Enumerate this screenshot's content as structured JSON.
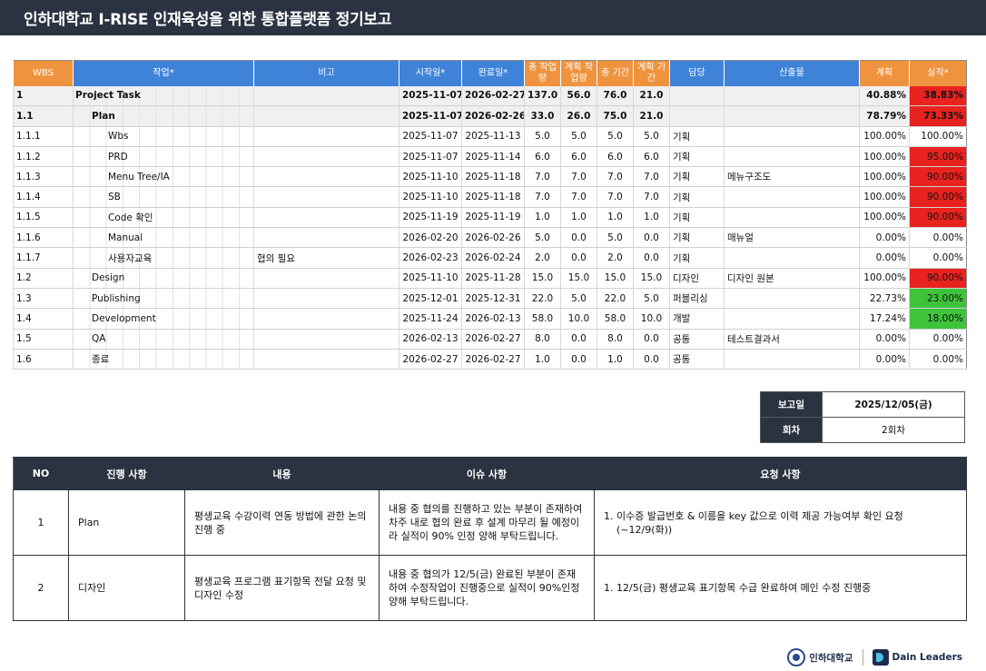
{
  "title": "인하대학교 I-RISE 인재육성을 위한 통합플랫폼 정기보고",
  "wbs_headers": {
    "wbs": "WBS",
    "task": "작업*",
    "note": "비고",
    "start": "시작일*",
    "end": "완료일*",
    "total_work": "총 작업량",
    "plan_work": "계획 작업량",
    "total_period": "총 기간",
    "plan_period": "계획 기간",
    "owner": "담당",
    "output": "산출물",
    "plan": "계획",
    "actual": "실적*"
  },
  "wbs_rows": [
    {
      "wbs": "1",
      "task": "Project Task",
      "level": 0,
      "note": "",
      "start": "2025-11-07",
      "end": "2026-02-27",
      "tw": "137.0",
      "pw": "56.0",
      "tp": "76.0",
      "pp": "21.0",
      "owner": "",
      "output": "",
      "plan": "40.88%",
      "actual": "38.83%",
      "actual_color": "red",
      "bold": true
    },
    {
      "wbs": "1.1",
      "task": "Plan",
      "level": 1,
      "note": "",
      "start": "2025-11-07",
      "end": "2026-02-26",
      "tw": "33.0",
      "pw": "26.0",
      "tp": "75.0",
      "pp": "21.0",
      "owner": "",
      "output": "",
      "plan": "78.79%",
      "actual": "73.33%",
      "actual_color": "red",
      "bold": true
    },
    {
      "wbs": "1.1.1",
      "task": "Wbs",
      "level": 2,
      "note": "",
      "start": "2025-11-07",
      "end": "2025-11-13",
      "tw": "5.0",
      "pw": "5.0",
      "tp": "5.0",
      "pp": "5.0",
      "owner": "기획",
      "output": "",
      "plan": "100.00%",
      "actual": "100.00%",
      "actual_color": "",
      "bold": false
    },
    {
      "wbs": "1.1.2",
      "task": "PRD",
      "level": 2,
      "note": "",
      "start": "2025-11-07",
      "end": "2025-11-14",
      "tw": "6.0",
      "pw": "6.0",
      "tp": "6.0",
      "pp": "6.0",
      "owner": "기획",
      "output": "",
      "plan": "100.00%",
      "actual": "95.00%",
      "actual_color": "red",
      "bold": false
    },
    {
      "wbs": "1.1.3",
      "task": "Menu Tree/IA",
      "level": 2,
      "note": "",
      "start": "2025-11-10",
      "end": "2025-11-18",
      "tw": "7.0",
      "pw": "7.0",
      "tp": "7.0",
      "pp": "7.0",
      "owner": "기획",
      "output": "메뉴구조도",
      "plan": "100.00%",
      "actual": "90.00%",
      "actual_color": "red",
      "bold": false
    },
    {
      "wbs": "1.1.4",
      "task": "SB",
      "level": 2,
      "note": "",
      "start": "2025-11-10",
      "end": "2025-11-18",
      "tw": "7.0",
      "pw": "7.0",
      "tp": "7.0",
      "pp": "7.0",
      "owner": "기획",
      "output": "",
      "plan": "100.00%",
      "actual": "90.00%",
      "actual_color": "red",
      "bold": false
    },
    {
      "wbs": "1.1.5",
      "task": "Code 확인",
      "level": 2,
      "note": "",
      "start": "2025-11-19",
      "end": "2025-11-19",
      "tw": "1.0",
      "pw": "1.0",
      "tp": "1.0",
      "pp": "1.0",
      "owner": "기획",
      "output": "",
      "plan": "100.00%",
      "actual": "90.00%",
      "actual_color": "red",
      "bold": false
    },
    {
      "wbs": "1.1.6",
      "task": "Manual",
      "level": 2,
      "note": "",
      "start": "2026-02-20",
      "end": "2026-02-26",
      "tw": "5.0",
      "pw": "0.0",
      "tp": "5.0",
      "pp": "0.0",
      "owner": "기획",
      "output": "매뉴얼",
      "plan": "0.00%",
      "actual": "0.00%",
      "actual_color": "",
      "bold": false
    },
    {
      "wbs": "1.1.7",
      "task": "사용자교육",
      "level": 2,
      "note": "협의 필요",
      "start": "2026-02-23",
      "end": "2026-02-24",
      "tw": "2.0",
      "pw": "0.0",
      "tp": "2.0",
      "pp": "0.0",
      "owner": "기획",
      "output": "",
      "plan": "0.00%",
      "actual": "0.00%",
      "actual_color": "",
      "bold": false
    },
    {
      "wbs": "1.2",
      "task": "Design",
      "level": 1,
      "note": "",
      "start": "2025-11-10",
      "end": "2025-11-28",
      "tw": "15.0",
      "pw": "15.0",
      "tp": "15.0",
      "pp": "15.0",
      "owner": "디자인",
      "output": "디자인 원본",
      "plan": "100.00%",
      "actual": "90.00%",
      "actual_color": "red",
      "bold": false
    },
    {
      "wbs": "1.3",
      "task": "Publishing",
      "level": 1,
      "note": "",
      "start": "2025-12-01",
      "end": "2025-12-31",
      "tw": "22.0",
      "pw": "5.0",
      "tp": "22.0",
      "pp": "5.0",
      "owner": "퍼블리싱",
      "output": "",
      "plan": "22.73%",
      "actual": "23.00%",
      "actual_color": "green",
      "bold": false
    },
    {
      "wbs": "1.4",
      "task": "Development",
      "level": 1,
      "note": "",
      "start": "2025-11-24",
      "end": "2026-02-13",
      "tw": "58.0",
      "pw": "10.0",
      "tp": "58.0",
      "pp": "10.0",
      "owner": "개발",
      "output": "",
      "plan": "17.24%",
      "actual": "18.00%",
      "actual_color": "green",
      "bold": false
    },
    {
      "wbs": "1.5",
      "task": "QA",
      "level": 1,
      "note": "",
      "start": "2026-02-13",
      "end": "2026-02-27",
      "tw": "8.0",
      "pw": "0.0",
      "tp": "8.0",
      "pp": "0.0",
      "owner": "공통",
      "output": "테스트결과서",
      "plan": "0.00%",
      "actual": "0.00%",
      "actual_color": "",
      "bold": false
    },
    {
      "wbs": "1.6",
      "task": "종료",
      "level": 1,
      "note": "",
      "start": "2026-02-27",
      "end": "2026-02-27",
      "tw": "1.0",
      "pw": "0.0",
      "tp": "1.0",
      "pp": "0.0",
      "owner": "공통",
      "output": "",
      "plan": "0.00%",
      "actual": "0.00%",
      "actual_color": "",
      "bold": false
    }
  ],
  "meta": {
    "report_date_label": "보고일",
    "report_date": "2025/12/05(금)",
    "round_label": "회차",
    "round": "2회차"
  },
  "issue_headers": {
    "no": "NO",
    "progress": "진행 사항",
    "content": "내용",
    "issue": "이슈 사항",
    "request": "요청 사항"
  },
  "issue_rows": [
    {
      "no": "1",
      "progress": "Plan",
      "content": "평생교육 수강이력 연동 방법에 관한 논의 진행 중",
      "issue": "내용 중 협의를 진행하고 있는 부분이 존재하여 차주 내로 협의 완료 후 설계 마무리 될 예정이라 실적이 90% 인정 양해 부탁드립니다.",
      "request": "이수증 발급번호 & 이름을 key 값으로 이력 제공 가능여부 확인 요청 (~12/9(화))"
    },
    {
      "no": "2",
      "progress": "디자인",
      "content": "평생교육 프로그램 표기항목 전달 요청 및 디자인 수정",
      "issue": "내용 중 협의가 12/5(금) 완료된 부분이 존재하여 수정작업이 진행중으로 실적이 90%인정 양해 부탁드립니다.",
      "request": "12/5(금) 평생교육 표기항목 수급 완료하여 메인 수정 진행중"
    }
  ],
  "logos": {
    "inha": "인하대학교",
    "dain": "Dain Leaders"
  },
  "colors": {
    "header_dark": "#2b3342",
    "orange": "#f0933f",
    "blue": "#3f83d9",
    "red": "#e8231f",
    "green": "#3ec43a"
  }
}
